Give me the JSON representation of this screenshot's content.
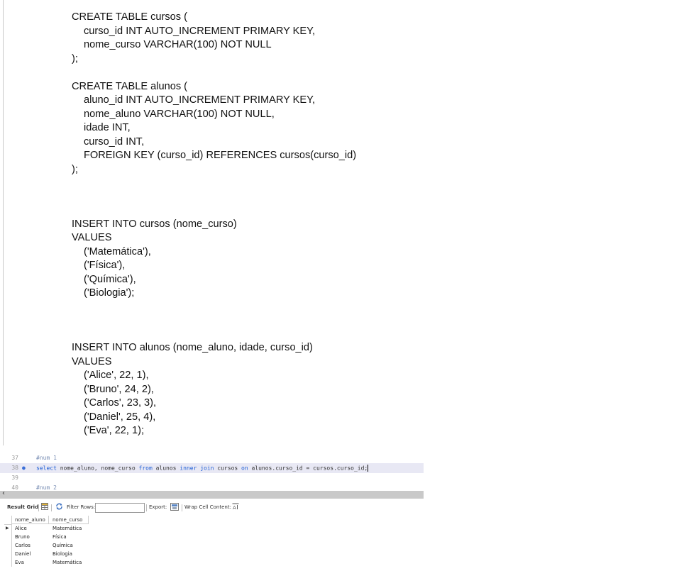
{
  "document": {
    "lines": [
      "CREATE TABLE cursos (",
      "curso_id INT AUTO_INCREMENT PRIMARY KEY,",
      "nome_curso VARCHAR(100) NOT NULL",
      ");",
      "CREATE TABLE alunos (",
      "aluno_id INT AUTO_INCREMENT PRIMARY KEY,",
      "nome_aluno VARCHAR(100) NOT NULL,",
      "idade INT,",
      "curso_id INT,",
      "FOREIGN KEY (curso_id) REFERENCES cursos(curso_id)",
      ");",
      "INSERT INTO cursos (nome_curso)",
      "VALUES",
      "('Matemática'),",
      "('Física'),",
      "('Química'),",
      "('Biologia');",
      "INSERT INTO alunos (nome_aluno, idade, curso_id)",
      "VALUES",
      "('Alice', 22, 1),",
      "('Bruno', 24, 2),",
      "('Carlos', 23, 3),",
      "('Daniel', 25, 4),",
      "('Eva', 22, 1);"
    ]
  },
  "editor": {
    "line_numbers": [
      "37",
      "38",
      "39",
      "40"
    ],
    "comment_1": "#num 1",
    "query": {
      "kw_select": "select",
      "cols": " nome_aluno, nome_curso ",
      "kw_from": "from",
      "t1": " alunos ",
      "kw_inner": "inner",
      "sp1": " ",
      "kw_join": "join",
      "t2": " cursos ",
      "kw_on": "on",
      "cond": " alunos.curso_id = cursos.curso_id;"
    },
    "comment_2": "#num 2"
  },
  "toolbar": {
    "result_grid_label": "Result Grid",
    "filter_rows_label": "Filter Rows:",
    "export_label": "Export:",
    "wrap_label": "Wrap Cell Content:"
  },
  "result_grid": {
    "columns": [
      "nome_aluno",
      "nome_curso"
    ],
    "rows": [
      [
        "Alice",
        "Matemática"
      ],
      [
        "Bruno",
        "Física"
      ],
      [
        "Carlos",
        "Química"
      ],
      [
        "Daniel",
        "Biologia"
      ],
      [
        "Eva",
        "Matemática"
      ]
    ]
  },
  "icons": {
    "grid": "grid-icon",
    "refresh": "refresh-icon",
    "export": "export-icon",
    "wrap": "wrap-icon",
    "row_pointer": "row-pointer-icon",
    "scroll_left": "scroll-left-arrow-icon"
  },
  "colors": {
    "keyword": "#1f5fd6",
    "comment": "#7a8fb5",
    "active_line": "#e8e8f4",
    "scrollbar": "#c9c9c9"
  }
}
